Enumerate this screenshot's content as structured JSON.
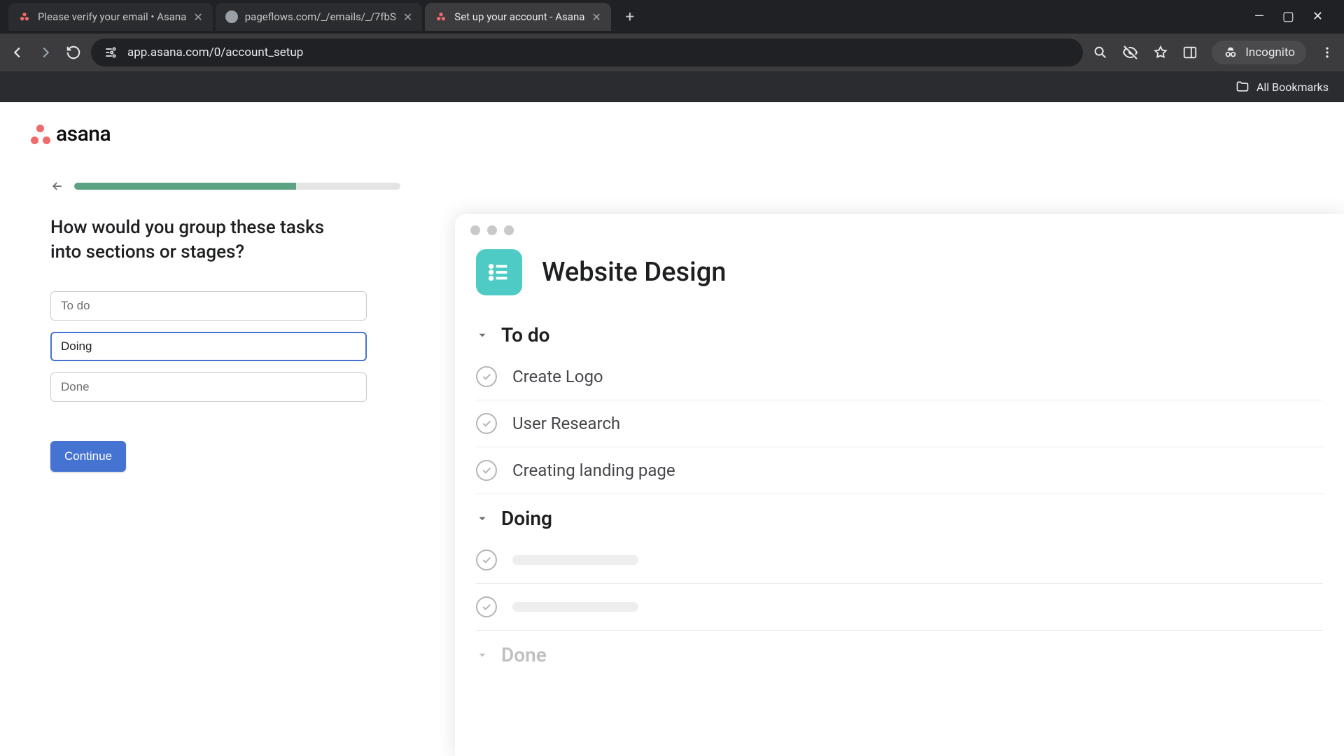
{
  "browser": {
    "tabs": [
      {
        "title": "Please verify your email • Asana",
        "favicon": "asana",
        "active": false
      },
      {
        "title": "pageflows.com/_/emails/_/7fbS",
        "favicon": "globe",
        "active": false
      },
      {
        "title": "Set up your account - Asana",
        "favicon": "asana",
        "active": true
      }
    ],
    "url": "app.asana.com/0/account_setup",
    "incognito_label": "Incognito",
    "bookmarks_label": "All Bookmarks"
  },
  "logo_text": "asana",
  "setup": {
    "progress_percent": 68,
    "question": "How would you group these tasks into sections or stages?",
    "sections": [
      {
        "value": "To do",
        "focused": false
      },
      {
        "value": "Doing",
        "focused": true
      },
      {
        "value": "Done",
        "focused": false
      }
    ],
    "continue_label": "Continue"
  },
  "preview": {
    "project_title": "Website Design",
    "groups": [
      {
        "name": "To do",
        "dim": false,
        "tasks": [
          "Create Logo",
          "User Research",
          "Creating landing page"
        ],
        "placeholders": 0
      },
      {
        "name": "Doing",
        "dim": false,
        "tasks": [],
        "placeholders": 2
      },
      {
        "name": "Done",
        "dim": true,
        "tasks": [],
        "placeholders": 0
      }
    ]
  }
}
